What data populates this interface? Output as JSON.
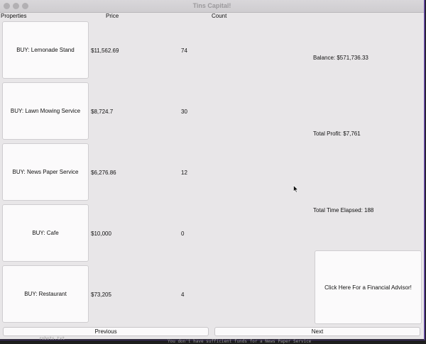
{
  "window": {
    "title": "Tins Capital!"
  },
  "headers": {
    "properties": "Properties",
    "price": "Price",
    "count": "Count"
  },
  "properties": [
    {
      "label": "BUY: Lemonade Stand",
      "price": "$11,562.69",
      "count": "74"
    },
    {
      "label": "BUY: Lawn Mowing Service",
      "price": "$8,724.7",
      "count": "30"
    },
    {
      "label": "BUY: News Paper Service",
      "price": "$6,276.86",
      "count": "12"
    },
    {
      "label": "BUY: Cafe",
      "price": "$10,000",
      "count": "0"
    },
    {
      "label": "BUY: Restaurant",
      "price": "$73,205",
      "count": "4"
    }
  ],
  "stats": {
    "balance": "Balance: $571,736.33",
    "total_profit": "Total Profit: $7,761",
    "time_elapsed": "Total Time Elapsed: 188"
  },
  "advisor_button": "Click Here For a Financial Advisor!",
  "nav": {
    "previous": "Previous",
    "next": "Next"
  },
  "background_terminal": {
    "file": "robots.txt",
    "message": "You don't have sufficient funds for a News Paper Service"
  },
  "colors": {
    "window_bg": "#e8e6e8",
    "button_bg": "#fbfafb",
    "accent_border": "#6f4fb0"
  },
  "icons": {
    "cursor": "mouse-pointer-icon"
  }
}
